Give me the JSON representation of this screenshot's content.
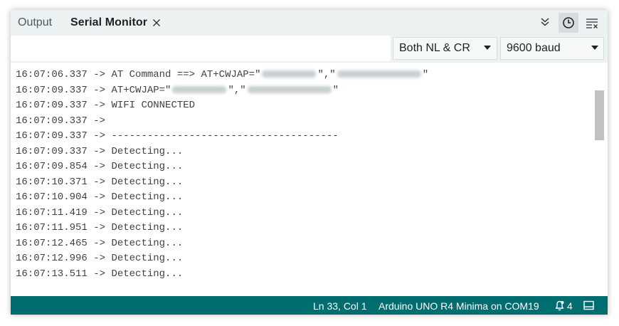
{
  "tabs": {
    "output_label": "Output",
    "serial_label": "Serial Monitor"
  },
  "toolbar": {
    "autoscroll_icon": "double-chevron-down-icon",
    "timestamp_icon": "clock-icon",
    "clear_icon": "clear-output-icon"
  },
  "input_row": {
    "message_value": "",
    "line_ending": "Both NL & CR",
    "baud_rate": "9600 baud"
  },
  "log": {
    "lines": [
      {
        "time": "16:07:06.337",
        "arrow": " -> ",
        "text": "AT Command ==> AT+CWJAP=\"",
        "redacted": true
      },
      {
        "time": "16:07:09.337",
        "arrow": " -> ",
        "text": "AT+CWJAP=\"",
        "redacted": true
      },
      {
        "time": "16:07:09.337",
        "arrow": " -> ",
        "text": "WIFI CONNECTED"
      },
      {
        "time": "16:07:09.337",
        "arrow": " -> ",
        "text": ""
      },
      {
        "time": "16:07:09.337",
        "arrow": " -> ",
        "text": "--------------------------------------"
      },
      {
        "time": "16:07:09.337",
        "arrow": " -> ",
        "text": "Detecting..."
      },
      {
        "time": "16:07:09.854",
        "arrow": " -> ",
        "text": "Detecting..."
      },
      {
        "time": "16:07:10.371",
        "arrow": " -> ",
        "text": "Detecting..."
      },
      {
        "time": "16:07:10.904",
        "arrow": " -> ",
        "text": "Detecting..."
      },
      {
        "time": "16:07:11.419",
        "arrow": " -> ",
        "text": "Detecting..."
      },
      {
        "time": "16:07:11.951",
        "arrow": " -> ",
        "text": "Detecting..."
      },
      {
        "time": "16:07:12.465",
        "arrow": " -> ",
        "text": "Detecting..."
      },
      {
        "time": "16:07:12.996",
        "arrow": " -> ",
        "text": "Detecting..."
      },
      {
        "time": "16:07:13.511",
        "arrow": " -> ",
        "text": "Detecting..."
      }
    ],
    "redacted_mid": "\",\"",
    "redacted_end": "\""
  },
  "statusbar": {
    "cursor_position": "Ln 33, Col 1",
    "board": "Arduino UNO R4 Minima on COM19",
    "notification_count": "4",
    "bg_color": "#006d70"
  }
}
